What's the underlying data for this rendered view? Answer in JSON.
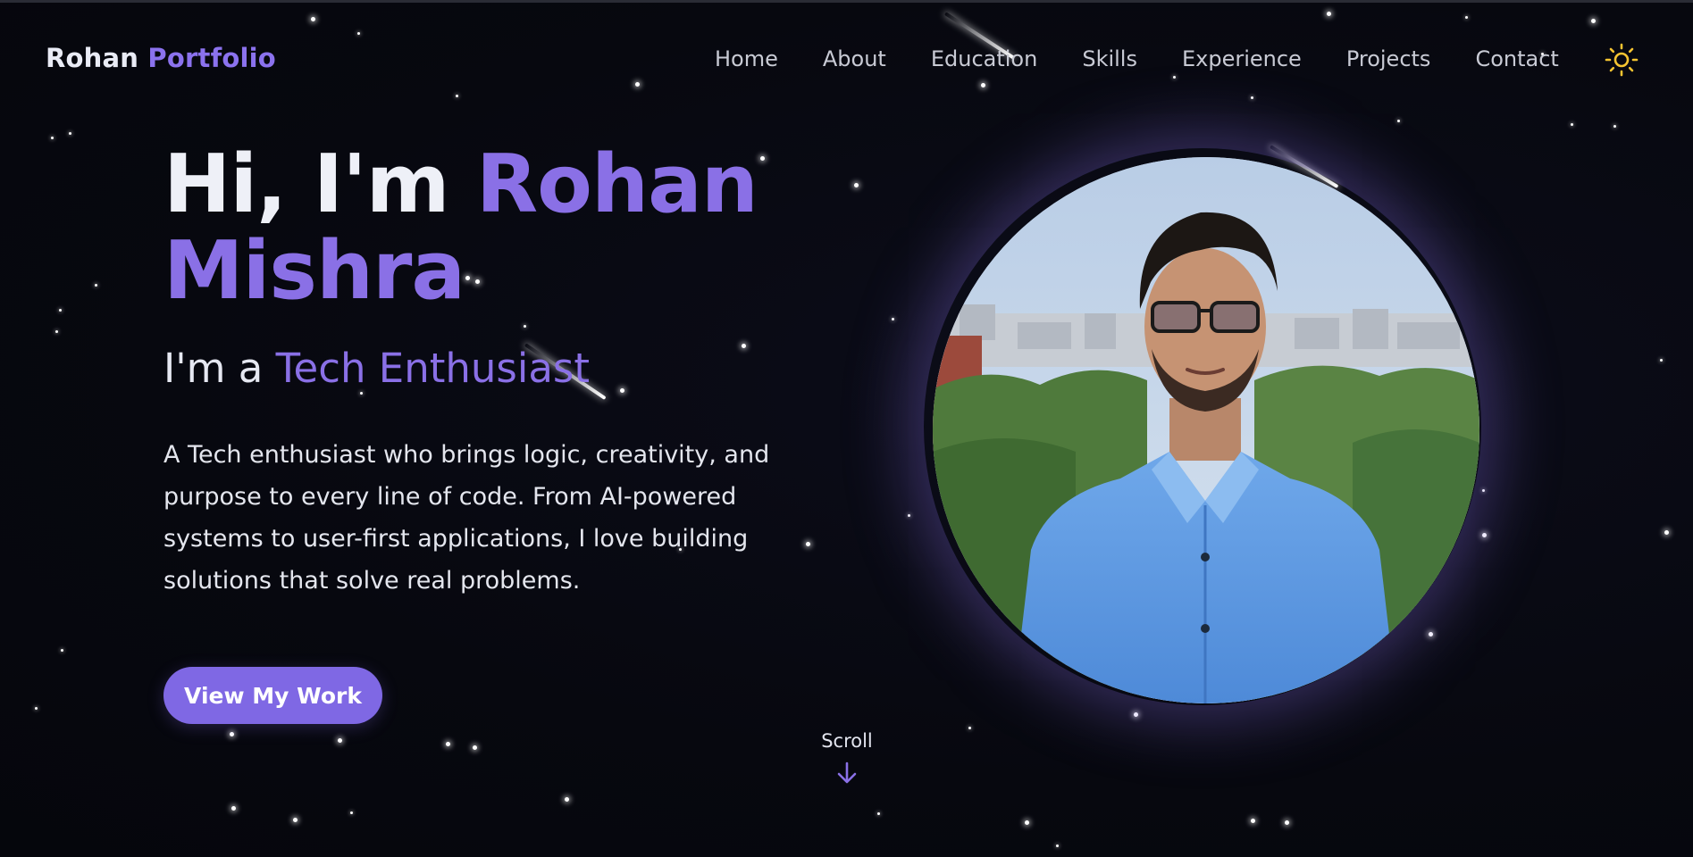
{
  "nav": {
    "logo_first": "Rohan",
    "logo_second": "Portfolio",
    "links": [
      "Home",
      "About",
      "Education",
      "Skills",
      "Experience",
      "Projects",
      "Contact"
    ],
    "theme_icon": "sun-icon"
  },
  "hero": {
    "greeting": "Hi, I'm",
    "name_line1": "Rohan",
    "name_line2": "Mishra",
    "subtitle_prefix": "I'm a",
    "subtitle_role": "Tech Enthusiast",
    "description": "A Tech enthusiast who brings logic, creativity, and purpose to every line of code. From AI-powered systems to user-first applications, I love building solutions that solve real problems.",
    "cta_label": "View My Work"
  },
  "scroll": {
    "label": "Scroll",
    "icon": "arrow-down-icon"
  },
  "profile": {
    "image": "profile-photo"
  },
  "colors": {
    "background": "#07080f",
    "accent": "#8a70e6",
    "button": "#7f68e4",
    "sun": "#f6c431",
    "text": "#eef0f7"
  }
}
